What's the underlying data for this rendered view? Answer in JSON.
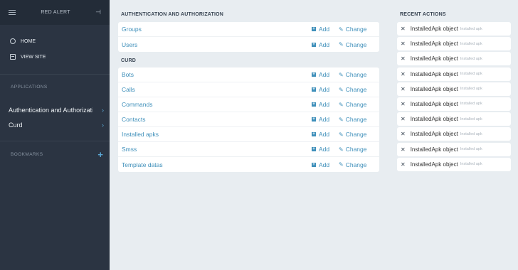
{
  "sidebar": {
    "title": "RED ALERT",
    "nav": [
      {
        "label": "HOME",
        "icon": "home-circle-icon"
      },
      {
        "label": "VIEW SITE",
        "icon": "site-icon"
      }
    ],
    "applications_header": "APPLICATIONS",
    "apps": [
      {
        "label": "Authentication and Authorization"
      },
      {
        "label": "Curd"
      }
    ],
    "bookmarks_header": "BOOKMARKS"
  },
  "main": {
    "auth_section": {
      "title": "AUTHENTICATION AND AUTHORIZATION",
      "models": [
        "Groups",
        "Users"
      ]
    },
    "curd_section": {
      "title": "CURD",
      "models": [
        "Bots",
        "Calls",
        "Commands",
        "Contacts",
        "Installed apks",
        "Smss",
        "Template datas"
      ]
    },
    "add_label": "Add",
    "change_label": "Change"
  },
  "recent_actions": {
    "title": "RECENT ACTIONS",
    "items": [
      {
        "object": "InstalledApk object",
        "type": "Installed apk"
      },
      {
        "object": "InstalledApk object",
        "type": "Installed apk"
      },
      {
        "object": "InstalledApk object",
        "type": "Installed apk"
      },
      {
        "object": "InstalledApk object",
        "type": "Installed apk"
      },
      {
        "object": "InstalledApk object",
        "type": "Installed apk"
      },
      {
        "object": "InstalledApk object",
        "type": "Installed apk"
      },
      {
        "object": "InstalledApk object",
        "type": "Installed apk"
      },
      {
        "object": "InstalledApk object",
        "type": "Installed apk"
      },
      {
        "object": "InstalledApk object",
        "type": "Installed apk"
      },
      {
        "object": "InstalledApk object",
        "type": "Installed apk"
      }
    ]
  },
  "colors": {
    "sidebar": "#2b3442",
    "accent": "#3e8fba",
    "background": "#e8edf1"
  }
}
